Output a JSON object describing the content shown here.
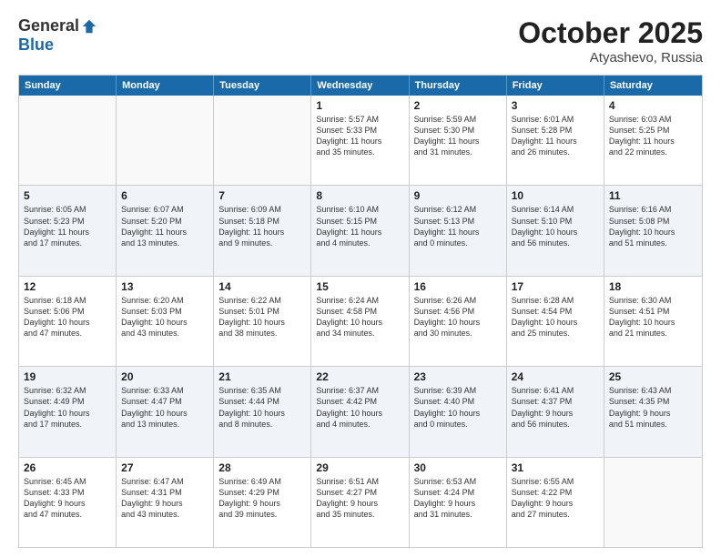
{
  "logo": {
    "general": "General",
    "blue": "Blue"
  },
  "title": "October 2025",
  "location": "Atyashevo, Russia",
  "days": [
    "Sunday",
    "Monday",
    "Tuesday",
    "Wednesday",
    "Thursday",
    "Friday",
    "Saturday"
  ],
  "rows": [
    [
      {
        "day": "",
        "text": ""
      },
      {
        "day": "",
        "text": ""
      },
      {
        "day": "",
        "text": ""
      },
      {
        "day": "1",
        "text": "Sunrise: 5:57 AM\nSunset: 5:33 PM\nDaylight: 11 hours\nand 35 minutes."
      },
      {
        "day": "2",
        "text": "Sunrise: 5:59 AM\nSunset: 5:30 PM\nDaylight: 11 hours\nand 31 minutes."
      },
      {
        "day": "3",
        "text": "Sunrise: 6:01 AM\nSunset: 5:28 PM\nDaylight: 11 hours\nand 26 minutes."
      },
      {
        "day": "4",
        "text": "Sunrise: 6:03 AM\nSunset: 5:25 PM\nDaylight: 11 hours\nand 22 minutes."
      }
    ],
    [
      {
        "day": "5",
        "text": "Sunrise: 6:05 AM\nSunset: 5:23 PM\nDaylight: 11 hours\nand 17 minutes."
      },
      {
        "day": "6",
        "text": "Sunrise: 6:07 AM\nSunset: 5:20 PM\nDaylight: 11 hours\nand 13 minutes."
      },
      {
        "day": "7",
        "text": "Sunrise: 6:09 AM\nSunset: 5:18 PM\nDaylight: 11 hours\nand 9 minutes."
      },
      {
        "day": "8",
        "text": "Sunrise: 6:10 AM\nSunset: 5:15 PM\nDaylight: 11 hours\nand 4 minutes."
      },
      {
        "day": "9",
        "text": "Sunrise: 6:12 AM\nSunset: 5:13 PM\nDaylight: 11 hours\nand 0 minutes."
      },
      {
        "day": "10",
        "text": "Sunrise: 6:14 AM\nSunset: 5:10 PM\nDaylight: 10 hours\nand 56 minutes."
      },
      {
        "day": "11",
        "text": "Sunrise: 6:16 AM\nSunset: 5:08 PM\nDaylight: 10 hours\nand 51 minutes."
      }
    ],
    [
      {
        "day": "12",
        "text": "Sunrise: 6:18 AM\nSunset: 5:06 PM\nDaylight: 10 hours\nand 47 minutes."
      },
      {
        "day": "13",
        "text": "Sunrise: 6:20 AM\nSunset: 5:03 PM\nDaylight: 10 hours\nand 43 minutes."
      },
      {
        "day": "14",
        "text": "Sunrise: 6:22 AM\nSunset: 5:01 PM\nDaylight: 10 hours\nand 38 minutes."
      },
      {
        "day": "15",
        "text": "Sunrise: 6:24 AM\nSunset: 4:58 PM\nDaylight: 10 hours\nand 34 minutes."
      },
      {
        "day": "16",
        "text": "Sunrise: 6:26 AM\nSunset: 4:56 PM\nDaylight: 10 hours\nand 30 minutes."
      },
      {
        "day": "17",
        "text": "Sunrise: 6:28 AM\nSunset: 4:54 PM\nDaylight: 10 hours\nand 25 minutes."
      },
      {
        "day": "18",
        "text": "Sunrise: 6:30 AM\nSunset: 4:51 PM\nDaylight: 10 hours\nand 21 minutes."
      }
    ],
    [
      {
        "day": "19",
        "text": "Sunrise: 6:32 AM\nSunset: 4:49 PM\nDaylight: 10 hours\nand 17 minutes."
      },
      {
        "day": "20",
        "text": "Sunrise: 6:33 AM\nSunset: 4:47 PM\nDaylight: 10 hours\nand 13 minutes."
      },
      {
        "day": "21",
        "text": "Sunrise: 6:35 AM\nSunset: 4:44 PM\nDaylight: 10 hours\nand 8 minutes."
      },
      {
        "day": "22",
        "text": "Sunrise: 6:37 AM\nSunset: 4:42 PM\nDaylight: 10 hours\nand 4 minutes."
      },
      {
        "day": "23",
        "text": "Sunrise: 6:39 AM\nSunset: 4:40 PM\nDaylight: 10 hours\nand 0 minutes."
      },
      {
        "day": "24",
        "text": "Sunrise: 6:41 AM\nSunset: 4:37 PM\nDaylight: 9 hours\nand 56 minutes."
      },
      {
        "day": "25",
        "text": "Sunrise: 6:43 AM\nSunset: 4:35 PM\nDaylight: 9 hours\nand 51 minutes."
      }
    ],
    [
      {
        "day": "26",
        "text": "Sunrise: 6:45 AM\nSunset: 4:33 PM\nDaylight: 9 hours\nand 47 minutes."
      },
      {
        "day": "27",
        "text": "Sunrise: 6:47 AM\nSunset: 4:31 PM\nDaylight: 9 hours\nand 43 minutes."
      },
      {
        "day": "28",
        "text": "Sunrise: 6:49 AM\nSunset: 4:29 PM\nDaylight: 9 hours\nand 39 minutes."
      },
      {
        "day": "29",
        "text": "Sunrise: 6:51 AM\nSunset: 4:27 PM\nDaylight: 9 hours\nand 35 minutes."
      },
      {
        "day": "30",
        "text": "Sunrise: 6:53 AM\nSunset: 4:24 PM\nDaylight: 9 hours\nand 31 minutes."
      },
      {
        "day": "31",
        "text": "Sunrise: 6:55 AM\nSunset: 4:22 PM\nDaylight: 9 hours\nand 27 minutes."
      },
      {
        "day": "",
        "text": ""
      }
    ]
  ]
}
